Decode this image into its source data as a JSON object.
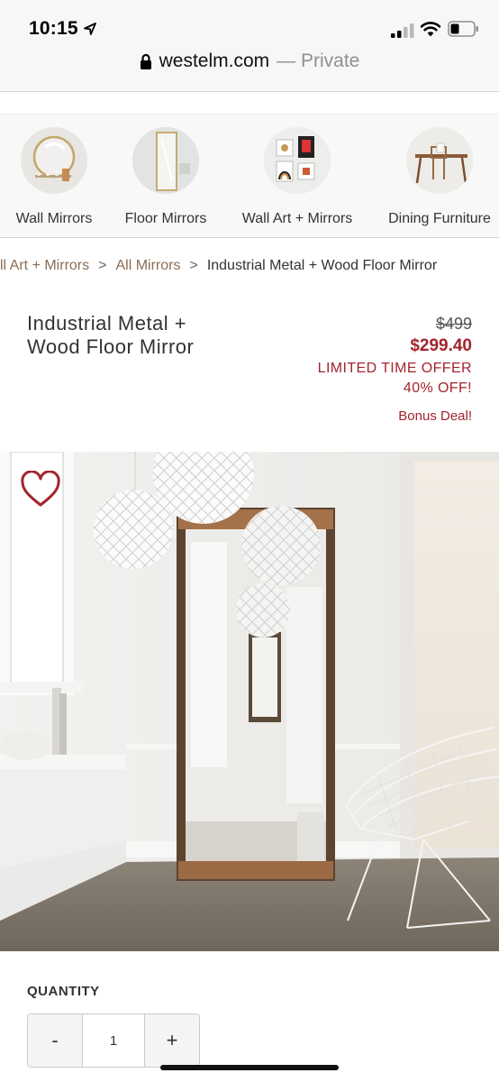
{
  "status_bar": {
    "time": "10:15"
  },
  "url_bar": {
    "domain": "westelm.com",
    "suffix": "— Private"
  },
  "categories": [
    {
      "label": "Wall Mirrors",
      "icon": "round-mirror-thumb"
    },
    {
      "label": "Floor Mirrors",
      "icon": "floor-mirror-thumb"
    },
    {
      "label": "Wall Art + Mirrors",
      "icon": "wall-art-thumb"
    },
    {
      "label": "Dining Furniture",
      "icon": "dining-table-thumb"
    }
  ],
  "breadcrumb": {
    "first": "ll Art + Mirrors",
    "second": "All Mirrors",
    "current": "Industrial Metal + Wood Floor Mirror",
    "separator": ">"
  },
  "product": {
    "title_line1": "Industrial Metal +",
    "title_line2": "Wood Floor Mirror",
    "price_original": "$499",
    "price_sale": "$299.40",
    "offer_line1": "LIMITED TIME OFFER",
    "offer_line2": "40% OFF!",
    "bonus": "Bonus Deal!"
  },
  "quantity": {
    "label": "QUANTITY",
    "value": "1",
    "minus": "-",
    "plus": "+"
  },
  "colors": {
    "accent_red": "#a3242e",
    "breadcrumb_brown": "#8a6d55",
    "bar_bg": "#f7f7f7"
  }
}
